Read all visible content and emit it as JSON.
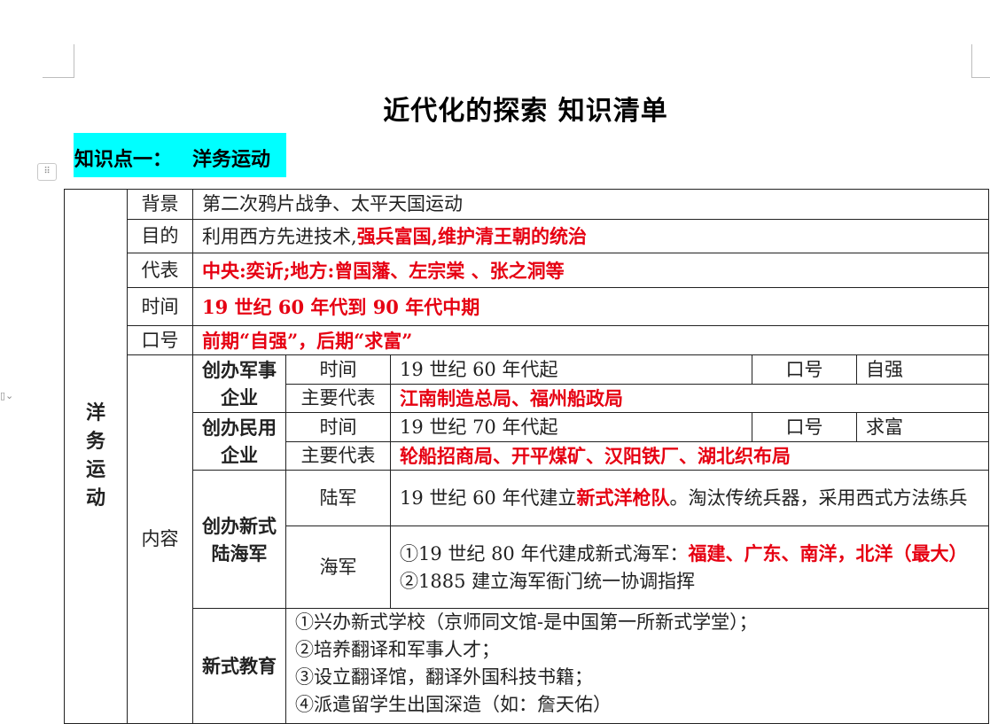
{
  "doc": {
    "title": "近代化的探索 知识清单",
    "section_heading": "知识点一：   洋务运动"
  },
  "table": {
    "topic": "洋务运动",
    "rows": {
      "background": {
        "label": "背景",
        "value": "第二次鸦片战争、太平天国运动"
      },
      "purpose": {
        "label": "目的",
        "value_plain": "利用西方先进技术,",
        "value_red": "强兵富国,维护清王朝的统治"
      },
      "representatives": {
        "label": "代表",
        "value": "中央:奕䜣;地方:曾国藩、左宗棠 、张之洞等"
      },
      "time": {
        "label": "时间",
        "value": "19 世纪 60 年代到 90 年代中期"
      },
      "slogan": {
        "label": "口号",
        "value": "前期“自强”，后期“求富”"
      }
    },
    "content_label": "内容",
    "military": {
      "label": "创办军事企业",
      "time_label": "时间",
      "time_value": "19 世纪 60 年代起",
      "slogan_label": "口号",
      "slogan_value": "自强",
      "rep_label": "主要代表",
      "rep_value": "江南制造总局、福州船政局"
    },
    "civil": {
      "label": "创办民用企业",
      "time_label": "时间",
      "time_value": "19 世纪 70 年代起",
      "slogan_label": "口号",
      "slogan_value": "求富",
      "rep_label": "主要代表",
      "rep_value": "轮船招商局、开平煤矿、汉阳铁厂、湖北织布局"
    },
    "forces": {
      "label": "创办新式陆海军",
      "army_label": "陆军",
      "army_a": "19 世纪 60 年代建立",
      "army_red": "新式洋枪队",
      "army_b": "。淘汰传统兵器，采用西式方法练兵",
      "navy_label": "海军",
      "navy_1a": "①19 世纪 80 年代建成新式海军：",
      "navy_1red": "福建、广东、南洋，北洋（最大）",
      "navy_2": "②1885 建立海军衙门统一协调指挥"
    },
    "education": {
      "label": "新式教育",
      "items": [
        "①兴办新式学校（京师同文馆-是中国第一所新式学堂）；",
        "②培养翻译和军事人才；",
        "③设立翻译馆，翻译外国科技书籍；",
        "④派遣留学生出国深造（如：詹天佑）"
      ]
    }
  }
}
